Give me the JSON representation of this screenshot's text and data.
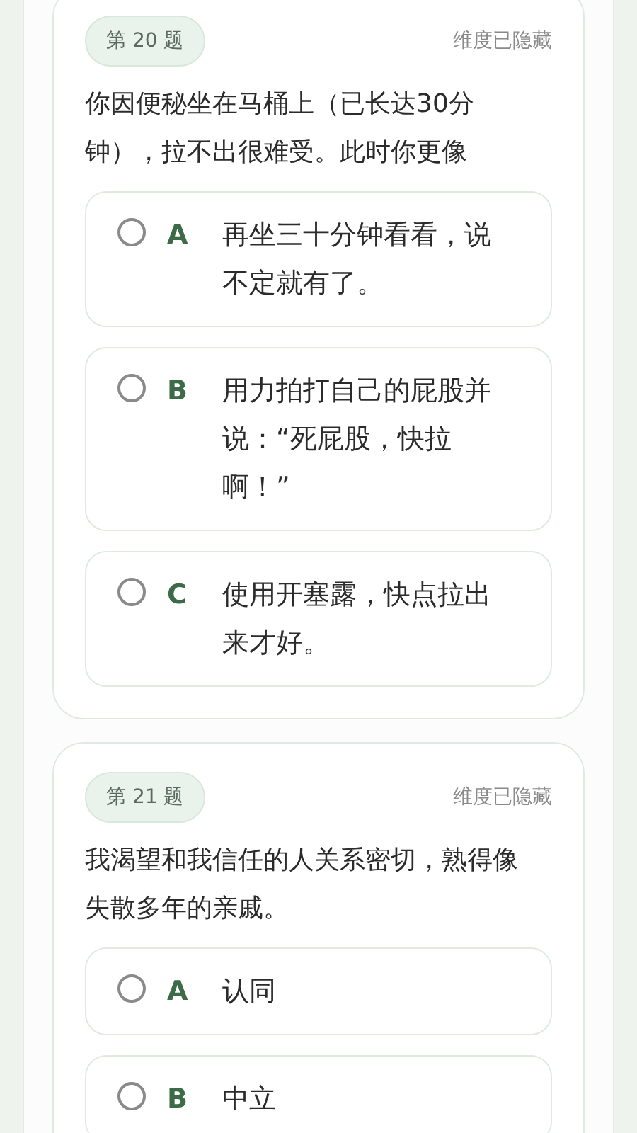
{
  "questions": [
    {
      "tag": "第 20 题",
      "dimension": "维度已隐藏",
      "text": "你因便秘坐在马桶上（已长达30分钟），拉不出很难受。此时你更像",
      "options": [
        {
          "letter": "A",
          "text": "再坐三十分钟看看，说不定就有了。",
          "selected": false
        },
        {
          "letter": "B",
          "text": "用力拍打自己的屁股并说：“死屁股，快拉啊！”",
          "selected": false
        },
        {
          "letter": "C",
          "text": "使用开塞露，快点拉出来才好。",
          "selected": false
        }
      ]
    },
    {
      "tag": "第 21 题",
      "dimension": "维度已隐藏",
      "text": "我渴望和我信任的人关系密切，熟得像失散多年的亲戚。",
      "options": [
        {
          "letter": "A",
          "text": "认同",
          "selected": false
        },
        {
          "letter": "B",
          "text": "中立",
          "selected": false
        }
      ]
    }
  ]
}
